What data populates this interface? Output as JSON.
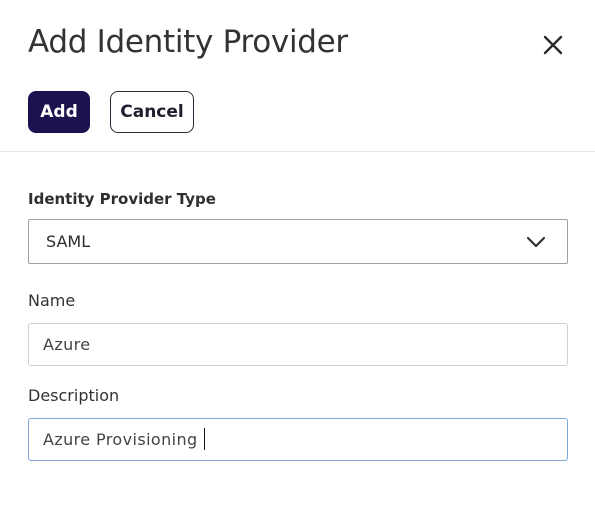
{
  "dialog": {
    "title": "Add Identity Provider",
    "close_icon": "close-icon"
  },
  "actions": {
    "add_label": "Add",
    "cancel_label": "Cancel",
    "primary_color": "#1b1350"
  },
  "form": {
    "type_label": "Identity Provider Type",
    "type_value": "SAML",
    "type_icon": "chevron-down-icon",
    "name_label": "Name",
    "name_value": "Azure",
    "description_label": "Description",
    "description_value": "Azure Provisioning"
  }
}
